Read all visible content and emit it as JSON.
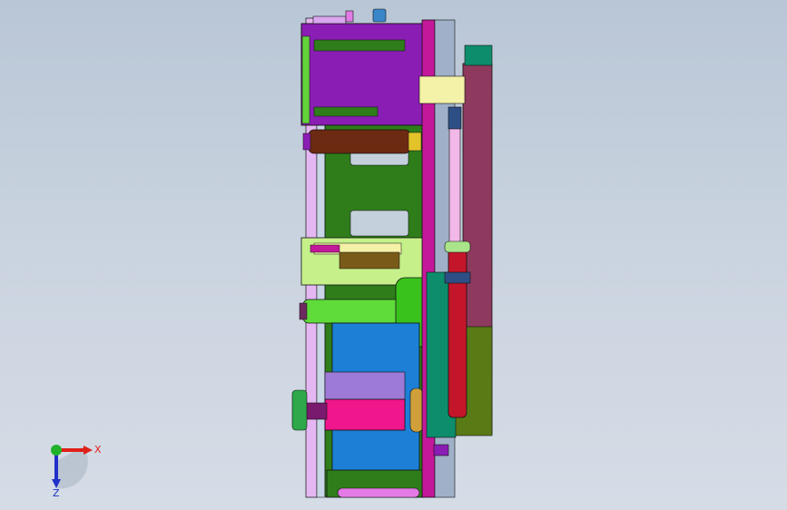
{
  "viewport": {
    "background_top": "#b9c6d6",
    "background_bottom": "#d5dce6"
  },
  "triad": {
    "x_label": "X",
    "y_label": "Y",
    "z_label": "Z",
    "x_color": "#e0201a",
    "y_color": "#1fb22a",
    "z_color": "#2030c8"
  },
  "model": {
    "colors": {
      "frame_purple": "#8a1db4",
      "magenta_plate": "#c4189a",
      "green_plate": "#2e7d1a",
      "light_green": "#b7f06a",
      "blue_block": "#1d7fd6",
      "pink_block": "#f0168c",
      "brown_roller": "#6d2a12",
      "maroon_plate": "#8d3a5e",
      "teal_block": "#0d8d6c",
      "red_cylinder": "#c4162a",
      "lavender_rail": "#d9a6ef",
      "yellow_beige": "#f4f1a8"
    }
  }
}
